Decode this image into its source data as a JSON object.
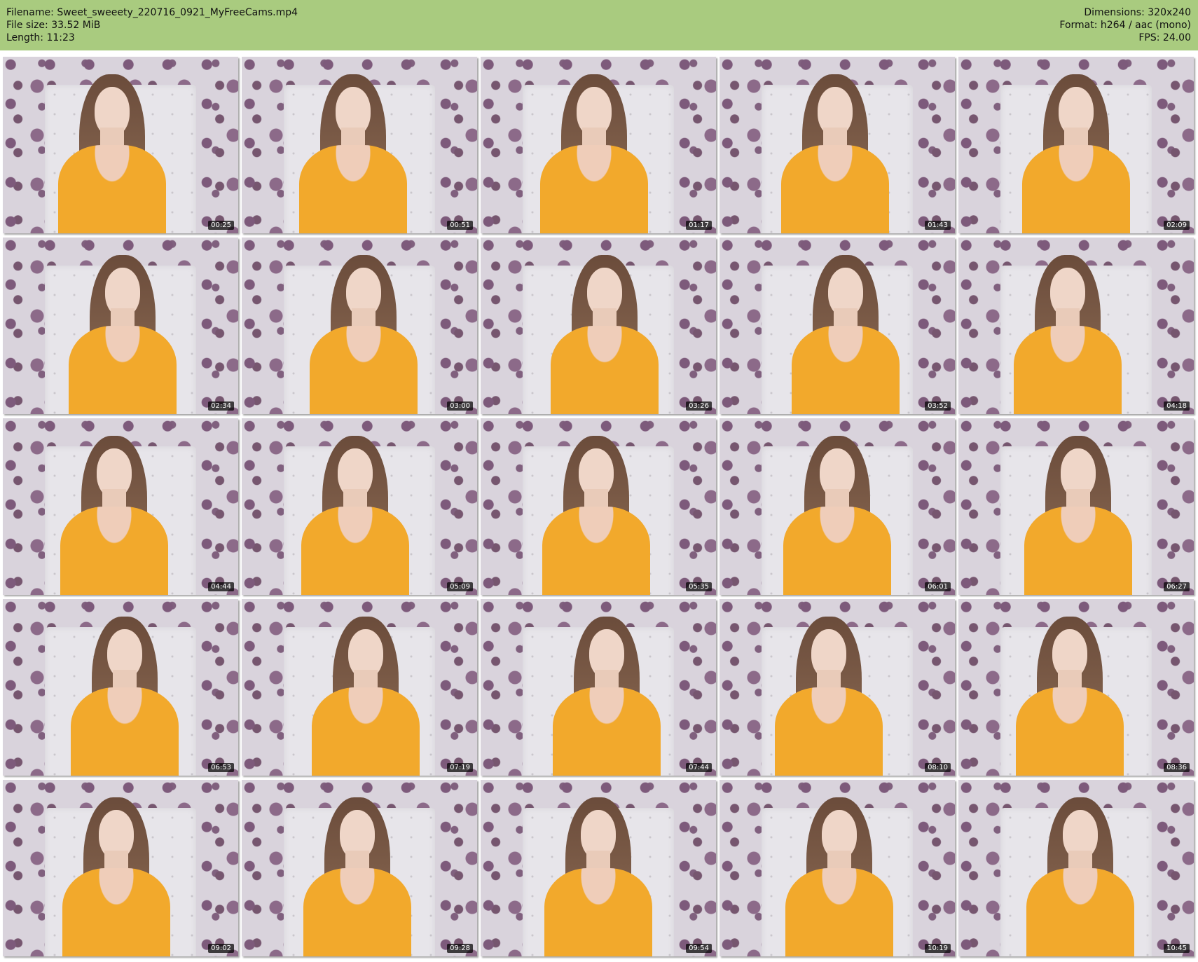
{
  "header": {
    "filename_label": "Filename:",
    "filename": "Sweet_sweeety_220716_0921_MyFreeCams.mp4",
    "filesize_label": "File size:",
    "filesize": "33.52 MiB",
    "length_label": "Length:",
    "length": "11:23",
    "dimensions_label": "Dimensions:",
    "dimensions": "320x240",
    "format_label": "Format:",
    "format": "h264 / aac (mono)",
    "fps_label": "FPS:",
    "fps": "24.00"
  },
  "colors": {
    "header_bg": "#a9cb7f",
    "shirt": "#f2a92c"
  },
  "thumbnails": [
    {
      "timestamp": "00:25"
    },
    {
      "timestamp": "00:51"
    },
    {
      "timestamp": "01:17"
    },
    {
      "timestamp": "01:43"
    },
    {
      "timestamp": "02:09"
    },
    {
      "timestamp": "02:34"
    },
    {
      "timestamp": "03:00"
    },
    {
      "timestamp": "03:26"
    },
    {
      "timestamp": "03:52"
    },
    {
      "timestamp": "04:18"
    },
    {
      "timestamp": "04:44"
    },
    {
      "timestamp": "05:09"
    },
    {
      "timestamp": "05:35"
    },
    {
      "timestamp": "06:01"
    },
    {
      "timestamp": "06:27"
    },
    {
      "timestamp": "06:53"
    },
    {
      "timestamp": "07:19"
    },
    {
      "timestamp": "07:44"
    },
    {
      "timestamp": "08:10"
    },
    {
      "timestamp": "08:36"
    },
    {
      "timestamp": "09:02"
    },
    {
      "timestamp": "09:28"
    },
    {
      "timestamp": "09:54"
    },
    {
      "timestamp": "10:19"
    },
    {
      "timestamp": "10:45"
    }
  ]
}
